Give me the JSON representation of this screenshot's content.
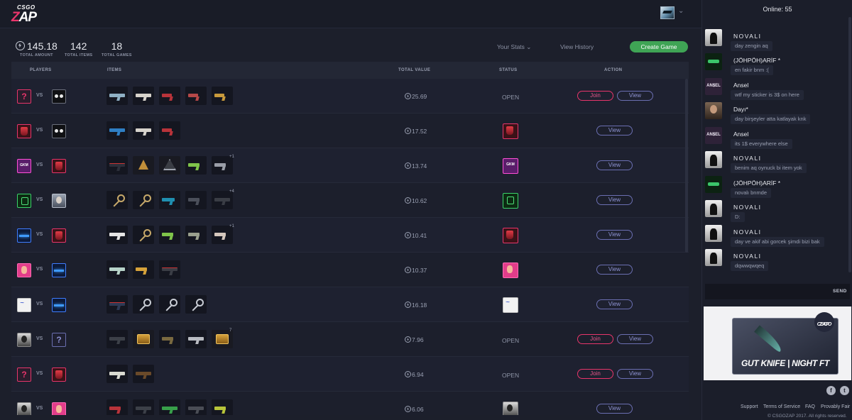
{
  "header": {
    "logo_top": "CSGO",
    "logo_bottom_a": "Z",
    "logo_bottom_b": "AP"
  },
  "stats": {
    "total_amount": "145.18",
    "total_amount_label": "TOTAL AMOUNT",
    "total_items": "142",
    "total_items_label": "TOTAL ITEMS",
    "total_games": "18",
    "total_games_label": "TOTAL GAMES"
  },
  "nav": {
    "your_stats": "Your Stats",
    "view_history": "View History",
    "create_game": "Create Game"
  },
  "table": {
    "columns": [
      "PLAYERS",
      "ITEMS",
      "TOTAL VALUE",
      "STATUS",
      "ACTION"
    ],
    "vs_label": "VS",
    "join_label": "Join",
    "view_label": "View",
    "rows": [
      {
        "value": "25.69",
        "status": "OPEN",
        "more": ""
      },
      {
        "value": "17.52",
        "status": "",
        "more": ""
      },
      {
        "value": "13.74",
        "status": "",
        "more": "+1"
      },
      {
        "value": "10.62",
        "status": "",
        "more": "+4"
      },
      {
        "value": "10.41",
        "status": "",
        "more": "+1"
      },
      {
        "value": "10.37",
        "status": "",
        "more": ""
      },
      {
        "value": "16.18",
        "status": "",
        "more": ""
      },
      {
        "value": "7.96",
        "status": "OPEN",
        "more": "7"
      },
      {
        "value": "6.94",
        "status": "OPEN",
        "more": ""
      },
      {
        "value": "6.06",
        "status": "",
        "more": ""
      }
    ]
  },
  "chat": {
    "online": "Online: 55",
    "messages": [
      {
        "name": "NOVALI",
        "text": "day zengin aq",
        "avatar": "novali-icon"
      },
      {
        "name": "(JÖHPÖH)ARİF *",
        "text": "en fakir bnm :(",
        "avatar": "johpoh-icon"
      },
      {
        "name": "Ansel",
        "text": "wtf my sticker is 3$ on here",
        "avatar": "ansel-icon"
      },
      {
        "name": "Dayı*",
        "text": "day birşeyler atta katlayak knk",
        "avatar": "dayi-icon"
      },
      {
        "name": "Ansel",
        "text": "its 1$ everywhere else",
        "avatar": "ansel-icon"
      },
      {
        "name": "NOVALI",
        "text": "benim aq oynuck bi item yok",
        "avatar": "novali-icon"
      },
      {
        "name": "(JÖHPÖH)ARİF *",
        "text": "novalı bnmde",
        "avatar": "johpoh-icon"
      },
      {
        "name": "NOVALI",
        "text": "D:",
        "avatar": "novali-icon"
      },
      {
        "name": "NOVALI",
        "text": "day ve akif abi gorcek şimdi bizi bak",
        "avatar": "novali-icon"
      },
      {
        "name": "NOVALI",
        "text": "dqwwqwqeq",
        "avatar": "novali-icon"
      }
    ],
    "send_label": "SEND"
  },
  "promo": {
    "title": "GUT KNIFE | NIGHT FT",
    "logo_top": "CSGO",
    "logo_bottom": "ZAP"
  },
  "footer": {
    "links": [
      "Support",
      "Terms of Service",
      "FAQ",
      "Provably Fair"
    ],
    "copyright": "© CSGOZAP 2017. All rights reserved.",
    "facebook": "f",
    "twitter": "t"
  },
  "colors": {
    "accent_pink": "#e8356b",
    "accent_green": "#3fa455",
    "view_purple": "#6b6fb2"
  }
}
